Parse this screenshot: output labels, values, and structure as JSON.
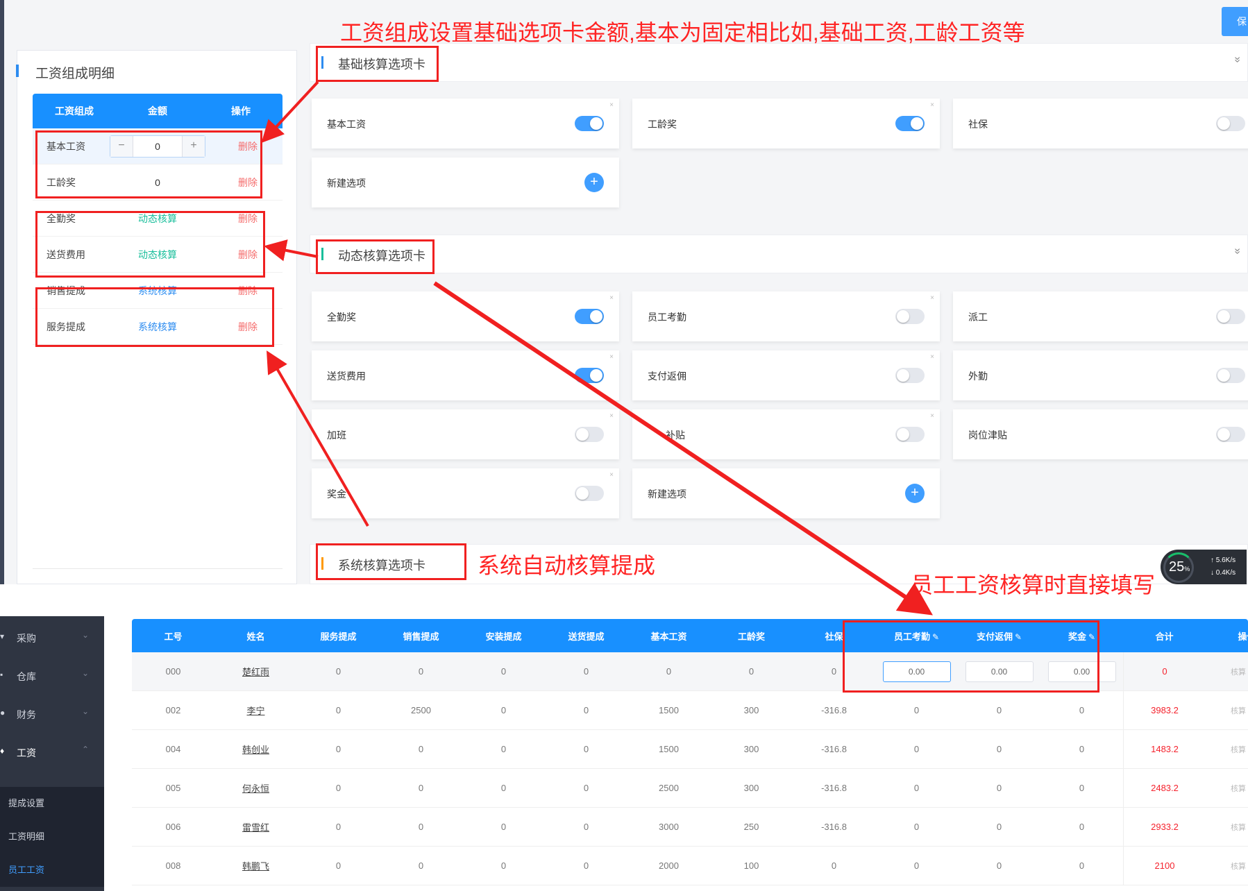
{
  "annotations": {
    "top_title": "工资组成设置基础选项卡金额,基本为固定相比如,基础工资,工龄工资等",
    "system_calc": "系统自动核算提成",
    "fill_direct": "员工工资核算时直接填写"
  },
  "detail_panel": {
    "title": "工资组成明细",
    "columns": [
      "工资组成",
      "金额",
      "操作"
    ],
    "stepper": {
      "minus": "−",
      "value": "0",
      "plus": "+"
    },
    "rows": [
      {
        "name": "基本工资",
        "amount": "0",
        "op": "删除"
      },
      {
        "name": "工龄奖",
        "amount": "0",
        "op": "删除"
      },
      {
        "name": "全勤奖",
        "amount": "动态核算",
        "op": "删除"
      },
      {
        "name": "送货费用",
        "amount": "动态核算",
        "op": "删除"
      },
      {
        "name": "销售提成",
        "amount": "系统核算",
        "op": "删除"
      },
      {
        "name": "服务提成",
        "amount": "系统核算",
        "op": "删除"
      }
    ]
  },
  "save_button": "保",
  "sections": {
    "basic": {
      "title": "基础核算选项卡",
      "chevron": "»",
      "cards": [
        {
          "label": "基本工资",
          "on": true,
          "close": "×"
        },
        {
          "label": "工龄奖",
          "on": true,
          "close": "×"
        },
        {
          "label": "社保",
          "on": false,
          "close": ""
        }
      ],
      "new_option": {
        "label": "新建选项",
        "plus": "+"
      }
    },
    "dynamic": {
      "title": "动态核算选项卡",
      "chevron": "»",
      "cards": [
        {
          "label": "全勤奖",
          "on": true,
          "close": "×"
        },
        {
          "label": "员工考勤",
          "on": false,
          "close": "×"
        },
        {
          "label": "派工",
          "on": false,
          "close": ""
        },
        {
          "label": "送货费用",
          "on": true,
          "close": "×"
        },
        {
          "label": "支付返佣",
          "on": false,
          "close": "×"
        },
        {
          "label": "外勤",
          "on": false,
          "close": ""
        },
        {
          "label": "加班",
          "on": false,
          "close": "×"
        },
        {
          "label": "补贴",
          "on": false,
          "close": "×"
        },
        {
          "label": "岗位津贴",
          "on": false,
          "close": ""
        },
        {
          "label": "奖金",
          "on": false,
          "close": "×"
        }
      ],
      "new_option": {
        "label": "新建选项",
        "plus": "+"
      }
    },
    "system": {
      "title": "系统核算选项卡"
    }
  },
  "speed_widget": {
    "percent": "25",
    "unit": "%",
    "up": "↑ 5.6K/s",
    "down": "↓ 0.4K/s"
  },
  "sidebar": {
    "items": [
      {
        "icon": "▾",
        "label": "采购",
        "arrow": "⌄"
      },
      {
        "icon": "▪",
        "label": "仓库",
        "arrow": "⌄"
      },
      {
        "icon": "●",
        "label": "财务",
        "arrow": "⌄"
      },
      {
        "icon": "♦",
        "label": "工资",
        "arrow": "⌃"
      }
    ],
    "subitems": [
      "提成设置",
      "工资明细",
      "员工工资"
    ]
  },
  "salary_table": {
    "columns": [
      "工号",
      "姓名",
      "服务提成",
      "销售提成",
      "安装提成",
      "送货提成",
      "基本工资",
      "工龄奖",
      "社保",
      "员工考勤",
      "支付返佣",
      "奖金",
      "合计",
      "操作"
    ],
    "editable_cols": [
      "员工考勤",
      "支付返佣",
      "奖金"
    ],
    "pen": "✎",
    "first_row": {
      "id": "000",
      "name": "楚红雨",
      "values": [
        "0",
        "0",
        "0",
        "0",
        "0",
        "0",
        "0"
      ],
      "inputs": [
        "0.00",
        "0.00",
        "0.00"
      ],
      "total": "0",
      "ops": "核算 发放"
    },
    "rows": [
      {
        "id": "002",
        "name": "李宁",
        "values": [
          "0",
          "2500",
          "0",
          "0",
          "1500",
          "300",
          "-316.8",
          "0",
          "0",
          "0"
        ],
        "total": "3983.2",
        "ops": "核算 发放"
      },
      {
        "id": "004",
        "name": "韩创业",
        "values": [
          "0",
          "0",
          "0",
          "0",
          "1500",
          "300",
          "-316.8",
          "0",
          "0",
          "0"
        ],
        "total": "1483.2",
        "ops": "核算 发放"
      },
      {
        "id": "005",
        "name": "何永恒",
        "values": [
          "0",
          "0",
          "0",
          "0",
          "2500",
          "300",
          "-316.8",
          "0",
          "0",
          "0"
        ],
        "total": "2483.2",
        "ops": "核算 发放"
      },
      {
        "id": "006",
        "name": "雷雪红",
        "values": [
          "0",
          "0",
          "0",
          "0",
          "3000",
          "250",
          "-316.8",
          "0",
          "0",
          "0"
        ],
        "total": "2933.2",
        "ops": "核算 发放"
      },
      {
        "id": "008",
        "name": "韩鹏飞",
        "values": [
          "0",
          "0",
          "0",
          "0",
          "2000",
          "100",
          "0",
          "0",
          "0",
          "0"
        ],
        "total": "2100",
        "ops": "核算 发放"
      }
    ]
  },
  "colors": {
    "primary": "#1890ff",
    "accent": "#409eff",
    "danger": "#f5222d",
    "annotation": "#ff2424"
  }
}
